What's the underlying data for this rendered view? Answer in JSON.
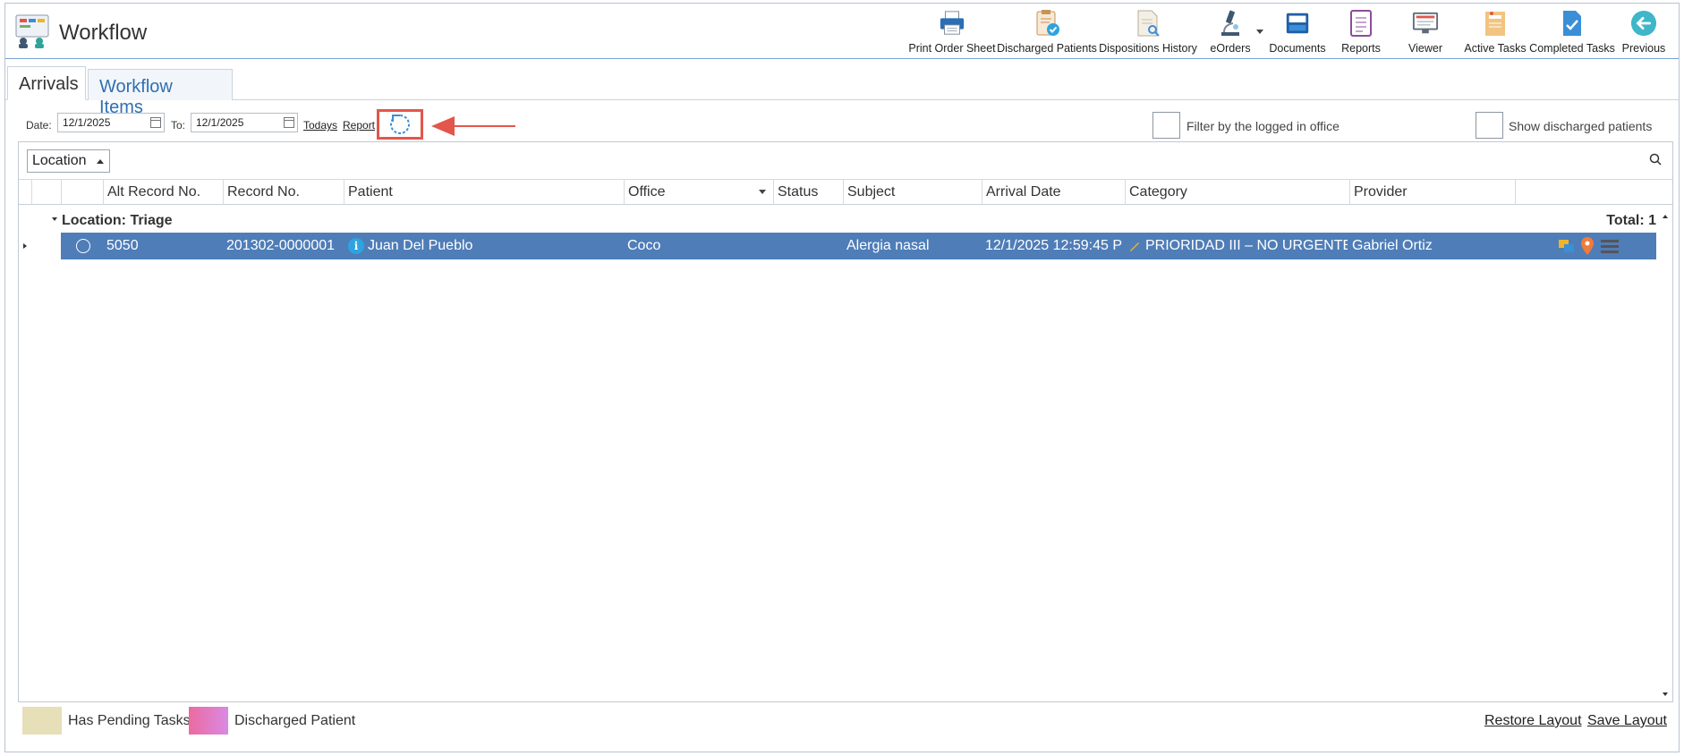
{
  "app": {
    "title": "Workflow"
  },
  "toolbar": {
    "print_order_sheet": "Print Order Sheet",
    "discharged_patients": "Discharged Patients",
    "dispositions_history": "Dispositions History",
    "eorders": "eOrders",
    "documents": "Documents",
    "reports": "Reports",
    "viewer": "Viewer",
    "active_tasks": "Active Tasks",
    "completed_tasks": "Completed Tasks",
    "previous": "Previous"
  },
  "tabs": {
    "arrivals": "Arrivals",
    "workflow_items": "Workflow Items"
  },
  "filters": {
    "date_label": "Date:",
    "date_from": "12/1/2025",
    "to_label": "To:",
    "date_to": "12/1/2025",
    "todays_link": "Todays",
    "report_link": "Report",
    "filter_office_label": "Filter by the logged in office",
    "show_discharged_label": "Show discharged patients"
  },
  "grid": {
    "group_by_chip": "Location",
    "columns": {
      "alt_record": "Alt Record No.",
      "record": "Record No.",
      "patient": "Patient",
      "office": "Office",
      "status": "Status",
      "subject": "Subject",
      "arrival_date": "Arrival Date",
      "category": "Category",
      "provider": "Provider"
    },
    "group": {
      "label": "Location: Triage",
      "total": "Total: 1"
    },
    "row": {
      "alt_record": "5050",
      "record": "201302-0000001",
      "patient": "Juan Del Pueblo",
      "office": "Coco",
      "status": "",
      "subject": "Alergia nasal",
      "arrival_date": "12/1/2025 12:59:45 P",
      "category": "PRIORIDAD III – NO URGENTE",
      "provider": "Gabriel Ortiz"
    }
  },
  "legend": {
    "pending": "Has Pending Tasks",
    "discharged": "Discharged Patient"
  },
  "footer": {
    "restore_layout": "Restore Layout",
    "save_layout": "Save Layout"
  },
  "colors": {
    "selected_row": "#4f7db8",
    "pending_swatch": "#e6dfb8",
    "discharged_swatch": "#ec6aa0",
    "highlight_red": "#e2564b",
    "tab_active_text": "#2f6fb3"
  }
}
